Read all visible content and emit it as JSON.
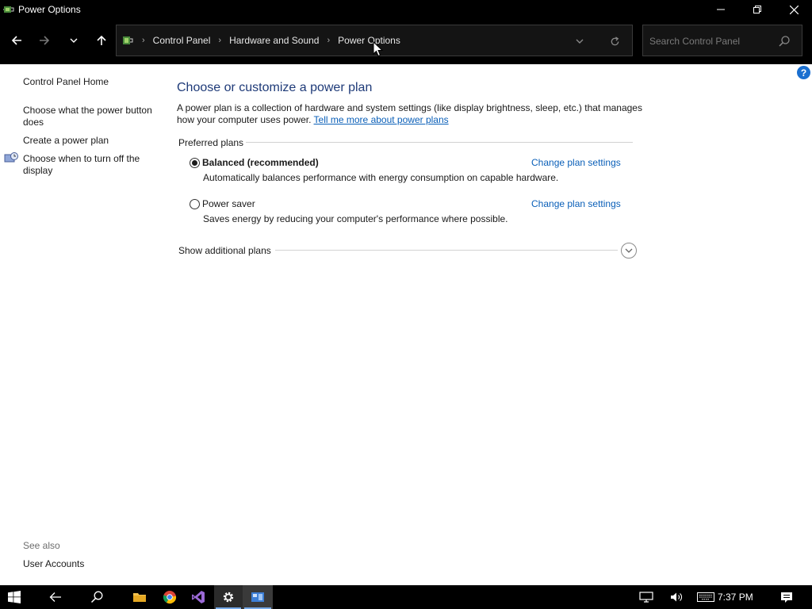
{
  "window": {
    "title": "Power Options",
    "minimize_label": "Minimize",
    "maximize_label": "Restore",
    "close_label": "Close"
  },
  "breadcrumb": {
    "items": [
      "Control Panel",
      "Hardware and Sound",
      "Power Options"
    ]
  },
  "search": {
    "placeholder": "Search Control Panel"
  },
  "sidebar": {
    "items": [
      {
        "label": "Control Panel Home"
      },
      {
        "label": "Choose what the power button does"
      },
      {
        "label": "Create a power plan"
      },
      {
        "label": "Choose when to turn off the display"
      }
    ],
    "see_also_label": "See also",
    "see_also_items": [
      {
        "label": "User Accounts"
      }
    ]
  },
  "main": {
    "heading": "Choose or customize a power plan",
    "description": "A power plan is a collection of hardware and system settings (like display brightness, sleep, etc.) that manages how your computer uses power.",
    "learn_more_link": "Tell me more about power plans",
    "preferred_plans_label": "Preferred plans",
    "plans": [
      {
        "name": "Balanced (recommended)",
        "description": "Automatically balances performance with energy consumption on capable hardware.",
        "change_link": "Change plan settings",
        "selected": true
      },
      {
        "name": "Power saver",
        "description": "Saves energy by reducing your computer's performance where possible.",
        "change_link": "Change plan settings",
        "selected": false
      }
    ],
    "additional_plans_label": "Show additional plans"
  },
  "help_label": "?",
  "taskbar": {
    "clock": "7:37 PM",
    "apps": [
      "start-icon",
      "back-icon",
      "search-icon",
      "file-explorer-icon",
      "chrome-icon",
      "visual-studio-icon",
      "settings-icon",
      "control-panel-icon"
    ]
  },
  "colors": {
    "accent": "#1e3a78",
    "link": "#0a5fb8",
    "titlebar": "#000000"
  }
}
